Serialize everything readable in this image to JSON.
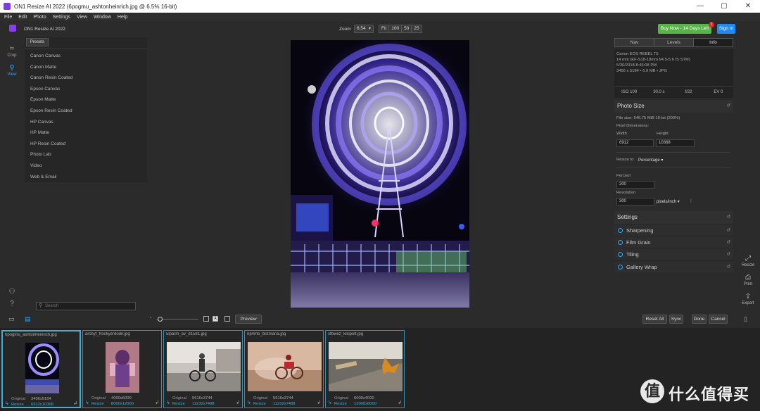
{
  "window": {
    "title": "ON1 Resize AI 2022 (6pogmu_ashtonheinrich.jpg @ 6.5% 16-bit)",
    "controls": [
      "—",
      "▢",
      "✕"
    ]
  },
  "menu": [
    "File",
    "Edit",
    "Photo",
    "Settings",
    "View",
    "Window",
    "Help"
  ],
  "app": {
    "name": "ON1 Resize AI 2022",
    "zoom_label": "Zoom",
    "zoom_value": "6.54",
    "zoom_buttons": [
      "Fit",
      "100",
      "50",
      "25"
    ],
    "buy_label": "Buy Now - 14 Days Left",
    "badge_count": "1",
    "signin_label": "Sign In"
  },
  "left_tools": {
    "crop": "Crop",
    "view": "View"
  },
  "presets": {
    "header": "Presets",
    "items": [
      "Canon Canvas",
      "Canon Matte",
      "Canon Resin Coated",
      "Epson Canvas",
      "Epson Matte",
      "Epson Resin Coated",
      "HP Canvas",
      "HP Matte",
      "HP Resin Coated",
      "Photo Lab",
      "Video",
      "Web & Email"
    ]
  },
  "panel": {
    "tabs": [
      "Nav",
      "Levels",
      "Info"
    ],
    "info": {
      "camera": "Canon EOS REBEL T5",
      "lens": "14 mm (EF-S18-18mm f/4.5-5.6 IS STM)",
      "date": "5/30/2018 8:46:08 PM",
      "size": "3456 x 5184 • 6.9 MB • JPG"
    },
    "exif": [
      "ISO 100",
      "30.0 s",
      "f/22",
      "EV 0"
    ],
    "photo_size": {
      "title": "Photo Size",
      "file_size": "File size: 546.75 MiB 16-bit (200%)",
      "pixel_dims": "Pixel Dimensions:",
      "width_label": "Width",
      "height_label": "Height",
      "width": "6912",
      "height": "10368",
      "resize_to_label": "Resize to:",
      "resize_to": "Percentage",
      "percent_label": "Percent",
      "percent": "200",
      "resolution_label": "Resolution",
      "resolution": "300",
      "resolution_unit": "pixels/inch"
    },
    "settings_title": "Settings",
    "settings": [
      "Sharpening",
      "Film Grain",
      "Tiling",
      "Gallery Wrap"
    ]
  },
  "right_tools": {
    "resize": "Resize",
    "print": "Print",
    "export": "Export"
  },
  "bottom": {
    "search_placeholder": "Search",
    "preview": "Preview",
    "reset_all": "Reset All",
    "sync": "Sync",
    "done": "Done",
    "cancel": "Cancel"
  },
  "filmstrip": [
    {
      "name": "6pogmu_ashtonheinrich.jpg",
      "original_label": "Original",
      "original": "3456x5184",
      "resize_label": "Resize",
      "resize": "6912x10368"
    },
    {
      "name": "archyt_frockyerdodir.jpg",
      "original_label": "Original",
      "original": "4000x6000",
      "resize_label": "Resize",
      "resize": "8000x12000"
    },
    {
      "name": "5lparm_av_d1581.jpg",
      "original_label": "Original",
      "original": "5616x3744",
      "resize_label": "Resize",
      "resize": "11232x7488"
    },
    {
      "name": "np4mb_blizmana.jpg",
      "original_label": "Original",
      "original": "5616x3744",
      "resize_label": "Resize",
      "resize": "11232x7488"
    },
    {
      "name": "xfbwez_kikipolf.jpg",
      "original_label": "Original",
      "original": "6000x4000",
      "resize_label": "Resize",
      "resize": "12000x8000"
    }
  ],
  "watermark": {
    "glyph": "值",
    "text": "什么值得买"
  }
}
